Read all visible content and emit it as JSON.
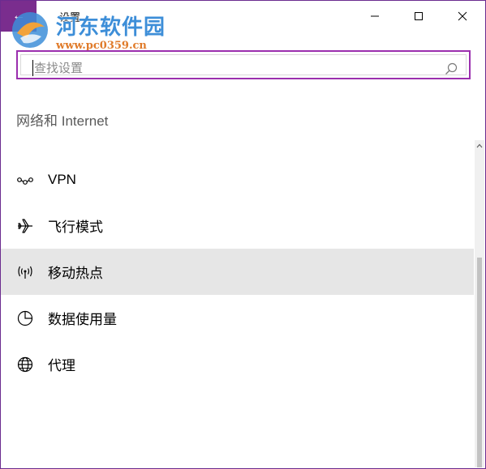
{
  "window": {
    "title": "设置",
    "back_label": "←",
    "controls": {
      "minimize": "minimize-icon",
      "maximize": "maximize-icon",
      "close": "close-icon"
    }
  },
  "watermark": {
    "name": "河东软件园",
    "url": "www.pc0359.cn"
  },
  "search": {
    "placeholder": "查找设置",
    "value": "",
    "icon": "search-icon"
  },
  "section": {
    "title": "网络和 Internet"
  },
  "nav": {
    "items": [
      {
        "label": "VPN",
        "icon": "vpn-icon",
        "selected": false
      },
      {
        "label": "飞行模式",
        "icon": "airplane-icon",
        "selected": false
      },
      {
        "label": "移动热点",
        "icon": "hotspot-icon",
        "selected": true
      },
      {
        "label": "数据使用量",
        "icon": "data-usage-icon",
        "selected": false
      },
      {
        "label": "代理",
        "icon": "globe-icon",
        "selected": false
      }
    ]
  },
  "colors": {
    "accent": "#7a2d8e",
    "search_border": "#9b2fae",
    "selected_bg": "#e6e6e6"
  }
}
